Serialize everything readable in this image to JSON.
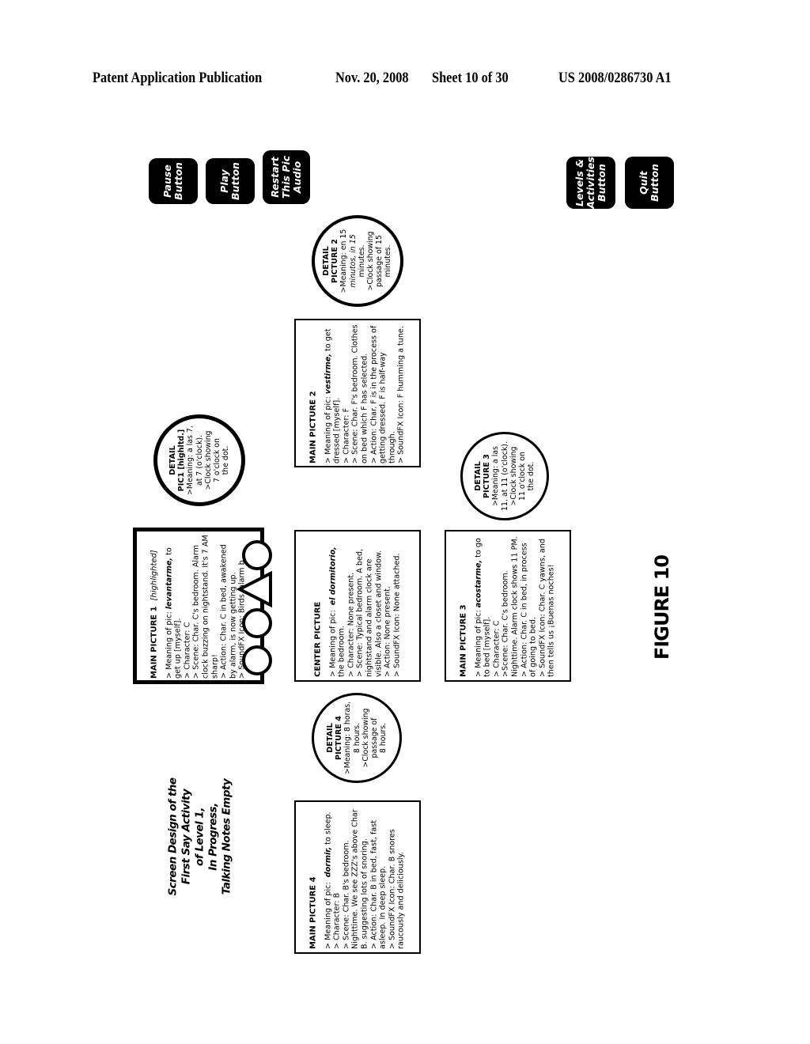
{
  "header": {
    "publication": "Patent Application Publication",
    "date": "Nov. 20, 2008",
    "sheet": "Sheet 10 of 30",
    "number": "US 2008/0286730 A1"
  },
  "buttons": {
    "pause": "Pause\nButton",
    "play": "Play\nButton",
    "restart": "Restart\nThis Pic\nAudio",
    "levels": "Levels &\nActivities\nButton",
    "quit": "Quit\nButton"
  },
  "title_block": "Screen Design of the\nFirst Say Activity\nof Level 1,\nIn Progress,\nTalking Notes Empty",
  "figure_label": "FIGURE 10",
  "main_picture_1": {
    "title": "MAIN PICTURE 1",
    "note": "[highlighted]",
    "meaning_prefix": "> Meaning of pic:",
    "meaning_word": "levantarme,",
    "meaning_suffix": "to get up [myself].",
    "character": "> Character:  C",
    "scene": "> Scene:  Char. C's bedroom. Alarm clock buzzing on nightstand. It's 7 AM sharp!",
    "action": "> Action:  Char. C in bed, awakened by alarm, is now getting up.",
    "soundfx": "> SoundFX Icon:  Birds, alarm b..."
  },
  "main_picture_2": {
    "title": "MAIN PICTURE 2",
    "meaning_prefix": "> Meaning of pic:",
    "meaning_word": "vestirme,",
    "meaning_suffix": "to get dressed [myself].",
    "character": "> Character:  F",
    "scene": "> Scene:  Char. F's bedroom. Clothes on bed which F has selected.",
    "action": "> Action:  Char. F is in the process of getting dressed.  F is half-way through.",
    "soundfx": "> SoundFX Icon:  F humming a tune."
  },
  "main_picture_3": {
    "title": "MAIN PICTURE 3",
    "meaning_prefix": "> Meaning of pic:",
    "meaning_word": "acostarme,",
    "meaning_suffix": "to go to bed [myself].",
    "character": "> Character:  C",
    "scene": ">Scene: Char. C's bedroom. Nighttime.  Alarm clock shows 11 PM.",
    "action": "> Action:  Char. C in bed, in process of going to bed.",
    "soundfx": "> SoundFX Icon:  Char. C yawns, and then tells us ¡Buenas noches!"
  },
  "main_picture_4": {
    "title": "MAIN PICTURE 4",
    "meaning_prefix": "> Meaning of pic:",
    "meaning_word": "dormir,",
    "meaning_suffix": "to sleep.",
    "character": "> Character:  B",
    "scene": "> Scene:  Char. B's bedroom. Nighttime.  We see ZZZ's above Char B. suggesting lots of snoring.",
    "action": "> Action:  Char. B in bed, fast, fast asleep.  In deep sleep.",
    "soundfx": "> SoundFX Icon:  Char. B snores raucously and deliciously."
  },
  "center_picture": {
    "title": "CENTER PICTURE",
    "meaning_prefix": "> Meaning of pic:",
    "meaning_word": "el dormitorio,",
    "meaning_suffix": "the bedroom.",
    "character": "> Character:  None present.",
    "scene": "> Scene:  Typical bedroom.  A bed, nightstand and alarm clock are visible.  Also a closet and window.",
    "action": "> Action:  None present.",
    "soundfx": "> SoundFX Icon:  None attached."
  },
  "detail_1": {
    "title": "DETAIL",
    "title2": "PIC1 [highltd.]",
    "line1": ">Meaning: a las 7,",
    "line2": "at 7 (o'clock).",
    "line3": ">Clock showing",
    "line4": "7 o'clock on",
    "line5": "the dot."
  },
  "detail_2": {
    "title": "DETAIL",
    "title2": "PICTURE  2",
    "line1": ">Meaning: en 15",
    "line2": "minutos, in 15",
    "line3": "minutes.",
    "line4": ">Clock showing",
    "line5": "passage of 15",
    "line6": "minutes."
  },
  "detail_3": {
    "title": "DETAIL",
    "title2": "PICTURE  3",
    "line1": ">Meaning: a las",
    "line2": "11, at 11 (o'clock).",
    "line3": ">Clock showing",
    "line4": "11 o'clock on",
    "line5": "the dot."
  },
  "detail_4": {
    "title": "DETAIL",
    "title2": "PICTURE  4",
    "line1": ">Meaning: 8 horas,",
    "line2": "8 hours.",
    "line3": ">Clock showing",
    "line4": "passage of",
    "line5": "8 hours."
  }
}
